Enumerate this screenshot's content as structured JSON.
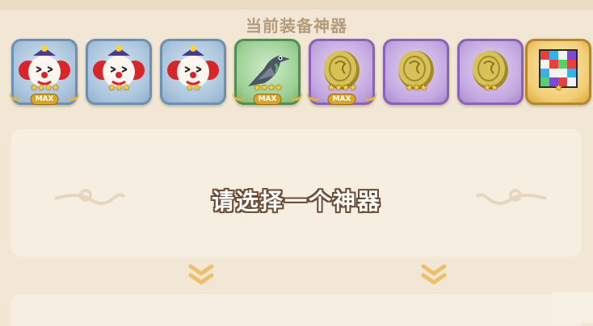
{
  "header": {
    "title": "当前装备神器"
  },
  "items": [
    {
      "name": "clown",
      "frame": "blue",
      "stars": "★★★★",
      "max_label": "MAX",
      "show_max": true
    },
    {
      "name": "clown",
      "frame": "blue",
      "stars": "★★★",
      "max_label": "",
      "show_max": false
    },
    {
      "name": "clown",
      "frame": "blue",
      "stars": "★★",
      "max_label": "",
      "show_max": false
    },
    {
      "name": "pigeon",
      "frame": "green",
      "stars": "★★★★",
      "max_label": "MAX",
      "show_max": true
    },
    {
      "name": "gold-coin",
      "frame": "purple",
      "stars": "★★★★",
      "max_label": "MAX",
      "show_max": true
    },
    {
      "name": "gold-coin",
      "frame": "purple",
      "stars": "★★★",
      "max_label": "",
      "show_max": false
    },
    {
      "name": "gold-coin",
      "frame": "purple",
      "stars": "★★",
      "max_label": "",
      "show_max": false
    },
    {
      "name": "pixel-cube",
      "frame": "gold",
      "stars": "★",
      "max_label": "",
      "show_max": false
    }
  ],
  "panel": {
    "prompt": "请选择一个神器"
  },
  "colors": {
    "background": "#f1e7d4",
    "panel": "#f6efe1",
    "accent": "#e8b52e",
    "text_outline": "#6d4d36"
  }
}
